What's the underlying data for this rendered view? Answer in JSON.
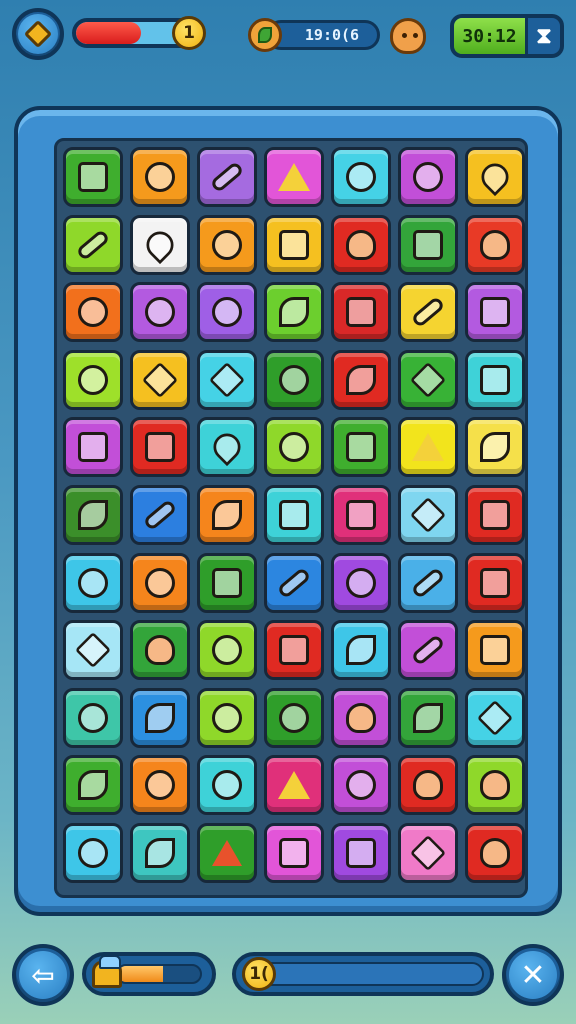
{
  "hud": {
    "health_fraction": 0.55,
    "health_fill_color": "#e02a22",
    "hint_coin_label": "1",
    "timer_text": "19:0(6",
    "timer_icon": "leaf-icon",
    "character_icon": "character-face-icon",
    "score_text": "30:12",
    "score_icon": "hourglass-icon"
  },
  "board": {
    "rows": 11,
    "cols": 7,
    "tiles": [
      [
        [
          "#3fae2e",
          "square"
        ],
        [
          "#f59a1c",
          "circle"
        ],
        [
          "#a56be0",
          "pill"
        ],
        [
          "#e255d8",
          "star"
        ],
        [
          "#45d2e6",
          "circle"
        ],
        [
          "#c24fd8",
          "circle"
        ],
        [
          "#f5c020",
          "drop"
        ]
      ],
      [
        [
          "#8fd82a",
          "pill"
        ],
        [
          "#f3f3f3",
          "drop"
        ],
        [
          "#f59a1c",
          "circle"
        ],
        [
          "#f5c020",
          "square"
        ],
        [
          "#e02a22",
          "face"
        ],
        [
          "#33a53a",
          "square"
        ],
        [
          "#e83a26",
          "face"
        ]
      ],
      [
        [
          "#f2701c",
          "circle"
        ],
        [
          "#b35ae0",
          "circle"
        ],
        [
          "#9f5fe6",
          "circle"
        ],
        [
          "#6ccf2e",
          "leaf"
        ],
        [
          "#d92828",
          "square"
        ],
        [
          "#f5d430",
          "pill"
        ],
        [
          "#b35ae0",
          "square"
        ]
      ],
      [
        [
          "#9ee02a",
          "circle"
        ],
        [
          "#f5c020",
          "diamond"
        ],
        [
          "#45d2e6",
          "diamond"
        ],
        [
          "#2f9e2a",
          "circle"
        ],
        [
          "#e02a22",
          "leaf"
        ],
        [
          "#38b236",
          "diamond"
        ],
        [
          "#3ed2d8",
          "square"
        ]
      ],
      [
        [
          "#c24fd8",
          "square"
        ],
        [
          "#e02a22",
          "square"
        ],
        [
          "#3ed2d8",
          "drop"
        ],
        [
          "#8fd82a",
          "circle"
        ],
        [
          "#3fae2e",
          "square"
        ],
        [
          "#f2e41c",
          "star"
        ],
        [
          "#f5e04a",
          "leaf"
        ]
      ],
      [
        [
          "#3b8f2a",
          "leaf"
        ],
        [
          "#2c7fe0",
          "pill"
        ],
        [
          "#f5851c",
          "leaf"
        ],
        [
          "#3ed2d8",
          "square"
        ],
        [
          "#e0307a",
          "square"
        ],
        [
          "#7fd6f0",
          "diamond"
        ],
        [
          "#e02a22",
          "square"
        ]
      ],
      [
        [
          "#3ec6e8",
          "circle"
        ],
        [
          "#f5851c",
          "circle"
        ],
        [
          "#2f9e2a",
          "square"
        ],
        [
          "#2c86e0",
          "pill"
        ],
        [
          "#a04ae0",
          "circle"
        ],
        [
          "#4ab0e8",
          "pill"
        ],
        [
          "#e02a22",
          "square"
        ]
      ],
      [
        [
          "#a6e6f6",
          "diamond"
        ],
        [
          "#33a53a",
          "face"
        ],
        [
          "#8fd82a",
          "circle"
        ],
        [
          "#e02a22",
          "square"
        ],
        [
          "#3ec6e8",
          "leaf"
        ],
        [
          "#c24fd8",
          "pill"
        ],
        [
          "#f59a1c",
          "square"
        ]
      ],
      [
        [
          "#3ec6a8",
          "circle"
        ],
        [
          "#2c90e0",
          "leaf"
        ],
        [
          "#8fd82a",
          "circle"
        ],
        [
          "#2f9e2a",
          "circle"
        ],
        [
          "#c24fd8",
          "face"
        ],
        [
          "#33a53a",
          "leaf"
        ],
        [
          "#45d2e6",
          "diamond"
        ]
      ],
      [
        [
          "#3fae2e",
          "leaf"
        ],
        [
          "#f5851c",
          "circle"
        ],
        [
          "#3ed2d8",
          "circle"
        ],
        [
          "#e0307a",
          "star"
        ],
        [
          "#c24fd8",
          "circle"
        ],
        [
          "#e02a22",
          "face"
        ],
        [
          "#8fd82a",
          "face"
        ]
      ],
      [
        [
          "#3ec6e8",
          "circle"
        ],
        [
          "#3ec6c0",
          "leaf"
        ],
        [
          "#2f9e2a",
          "tri"
        ],
        [
          "#e255d8",
          "square"
        ],
        [
          "#a04ae0",
          "square"
        ],
        [
          "#f07ac8",
          "diamond"
        ],
        [
          "#e02a22",
          "face"
        ]
      ]
    ]
  },
  "footer": {
    "back_icon": "arrow-left-icon",
    "back_label": "⇦",
    "power_fraction": 0.55,
    "power_icon": "bucket-icon",
    "level_coin_label": "1(",
    "close_icon": "close-icon",
    "close_label": "✕"
  }
}
